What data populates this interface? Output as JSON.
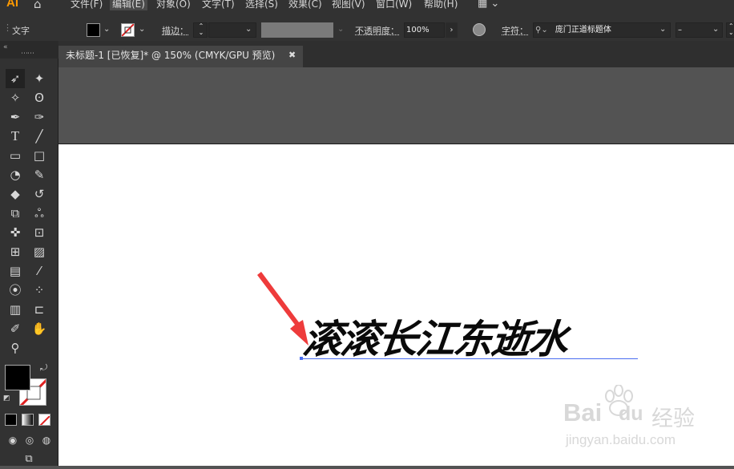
{
  "app": {
    "logo": "Ai",
    "home_icon": "home-icon"
  },
  "menu": {
    "items": [
      "文件(F)",
      "编辑(E)",
      "对象(O)",
      "文字(T)",
      "选择(S)",
      "效果(C)",
      "视图(V)",
      "窗口(W)",
      "帮助(H)"
    ],
    "workspace_icon": "workspace-icon"
  },
  "control": {
    "mode_label": "文字",
    "stroke_label": "描边：",
    "opacity_label": "不透明度：",
    "opacity_value": "100%",
    "char_label": "字符：",
    "font_name": "庞门正道标题体",
    "font_style": "–",
    "fill_color": "#000000",
    "stroke_color": "none"
  },
  "document": {
    "tab_title": "未标题-1 [已恢复]* @ 150% (CMYK/GPU 预览)",
    "close_glyph": "✖"
  },
  "canvas": {
    "text": "滚滚长江东逝水"
  },
  "watermark": {
    "brand": "Bai",
    "brand_tail": "du",
    "site_label": "经验",
    "url": "jingyan.baidu.com"
  }
}
